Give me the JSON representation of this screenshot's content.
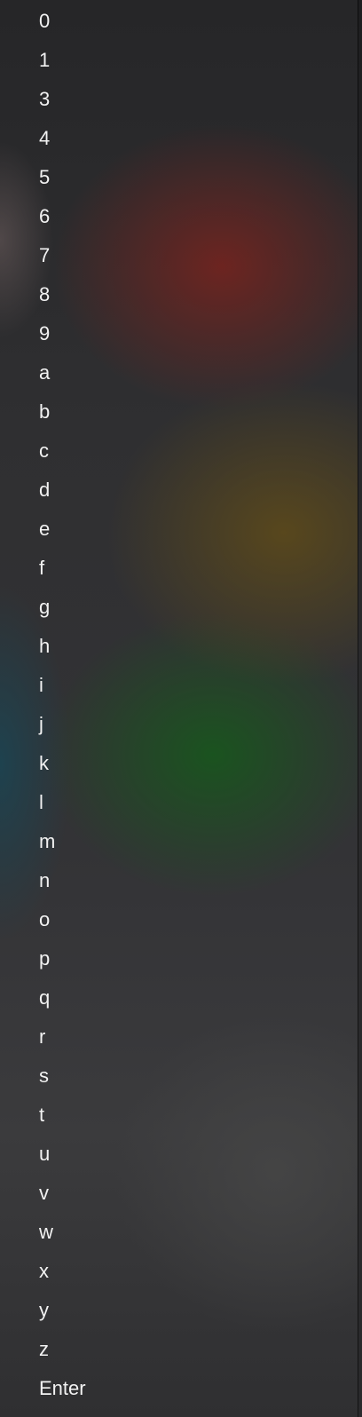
{
  "keyboard_menu": {
    "keys": [
      "0",
      "1",
      "3",
      "4",
      "5",
      "6",
      "7",
      "8",
      "9",
      "a",
      "b",
      "c",
      "d",
      "e",
      "f",
      "g",
      "h",
      "i",
      "j",
      "k",
      "l",
      "m",
      "n",
      "o",
      "p",
      "q",
      "r",
      "s",
      "t",
      "u",
      "v",
      "w",
      "x",
      "y",
      "z",
      "Enter"
    ]
  }
}
